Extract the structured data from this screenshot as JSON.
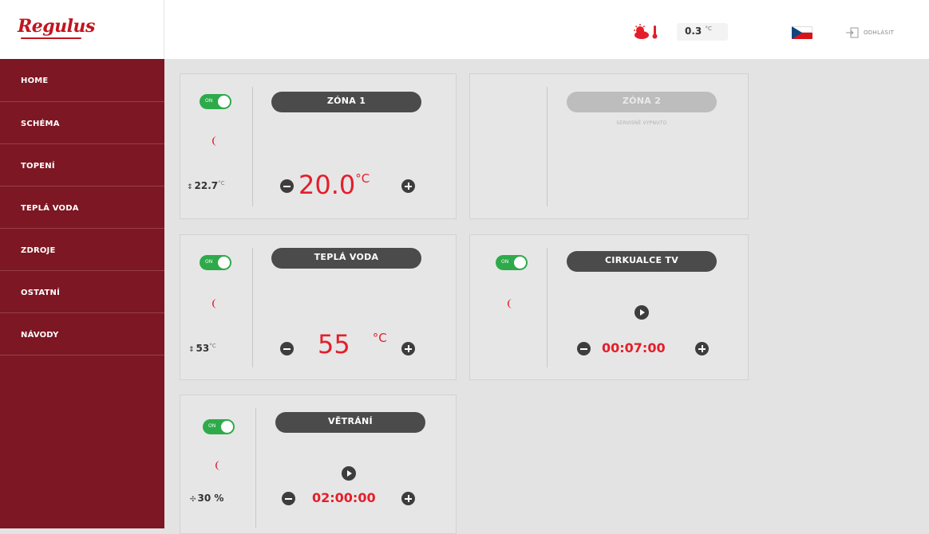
{
  "header": {
    "logo": "Regulus",
    "outside_temp": "0.3",
    "outside_unit": "°C",
    "weather_icon": "sun-cloud-thermometer-icon",
    "language_flag": "czech-flag-icon",
    "logout_label": "ODHLÁSIT"
  },
  "sidebar": {
    "items": [
      {
        "label": "HOME"
      },
      {
        "label": "SCHÉMA"
      },
      {
        "label": "TOPENÍ"
      },
      {
        "label": "TEPLÁ VODA"
      },
      {
        "label": "ZDROJE"
      },
      {
        "label": "OSTATNÍ"
      },
      {
        "label": "NÁVODY"
      }
    ]
  },
  "cards": {
    "zona1": {
      "title": "ZÓNA 1",
      "toggle": "ON",
      "actual": "22.7",
      "actual_unit": "°C",
      "setpoint": "20.0",
      "setpoint_unit": "°C"
    },
    "zona2": {
      "title": "ZÓNA 2",
      "status": "SERVISNĚ VYPNUTO"
    },
    "tepla_voda": {
      "title": "TEPLÁ VODA",
      "toggle": "ON",
      "actual": "53",
      "actual_unit": "°C",
      "setpoint": "55",
      "setpoint_unit": "°C"
    },
    "cirkulace": {
      "title": "CIRKUALCE TV",
      "toggle": "ON",
      "timer": "00:07:00"
    },
    "vetrani": {
      "title": "VĚTRÁNÍ",
      "toggle": "ON",
      "fan_value": "30 %",
      "timer": "02:00:00"
    }
  },
  "colors": {
    "accent": "#e41e2b",
    "sidebar": "#7c1723",
    "toggle_on": "#2eaa4a",
    "pill": "#4b4b4b"
  }
}
